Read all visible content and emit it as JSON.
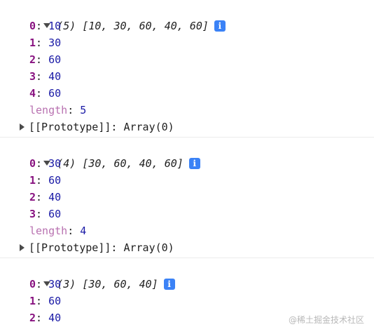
{
  "entries": [
    {
      "count": "(5)",
      "preview": "[10, 30, 60, 40, 60]",
      "items": [
        {
          "key": "0",
          "value": "10"
        },
        {
          "key": "1",
          "value": "30"
        },
        {
          "key": "2",
          "value": "60"
        },
        {
          "key": "3",
          "value": "40"
        },
        {
          "key": "4",
          "value": "60"
        }
      ],
      "length_label": "length",
      "length_value": "5",
      "prototype_label": "[[Prototype]]",
      "prototype_value": "Array(0)"
    },
    {
      "count": "(4)",
      "preview": "[30, 60, 40, 60]",
      "items": [
        {
          "key": "0",
          "value": "30"
        },
        {
          "key": "1",
          "value": "60"
        },
        {
          "key": "2",
          "value": "40"
        },
        {
          "key": "3",
          "value": "60"
        }
      ],
      "length_label": "length",
      "length_value": "4",
      "prototype_label": "[[Prototype]]",
      "prototype_value": "Array(0)"
    },
    {
      "count": "(3)",
      "preview": "[30, 60, 40]",
      "items": [
        {
          "key": "0",
          "value": "30"
        },
        {
          "key": "1",
          "value": "60"
        },
        {
          "key": "2",
          "value": "40"
        }
      ]
    }
  ],
  "info_icon_glyph": "i",
  "icons": {
    "expanded": "triangle-down-icon",
    "collapsed": "triangle-right-icon",
    "info": "info-icon"
  },
  "colors": {
    "key": "#881280",
    "number": "#1a1aa6",
    "length_key": "#b871b0",
    "info_badge": "#3b82f6"
  },
  "watermark": "@稀土掘金技术社区"
}
